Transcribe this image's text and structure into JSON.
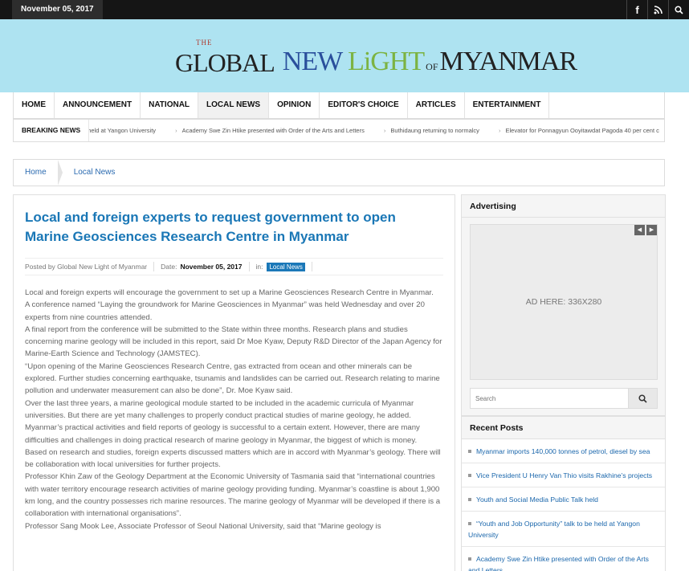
{
  "topbar": {
    "date": "November 05, 2017",
    "social": [
      {
        "icon": "facebook-icon",
        "glyph": "f"
      },
      {
        "icon": "rss-icon",
        "glyph": "⊃"
      },
      {
        "icon": "search-icon",
        "glyph": "⌕"
      }
    ]
  },
  "logo": {
    "the": "THE",
    "global": "GLOBAL",
    "new": "NEW ",
    "li": "LiGHT",
    "of": "OF",
    "myanmar": "MYANMAR"
  },
  "nav": {
    "items": [
      "HOME",
      "ANNOUNCEMENT",
      "NATIONAL",
      "LOCAL NEWS",
      "OPINION",
      "EDITOR'S CHOICE",
      "ARTICLES",
      "ENTERTAINMENT"
    ],
    "active": "LOCAL NEWS"
  },
  "breaking": {
    "label": "BREAKING NEWS",
    "items": [
      "e held at Yangon University",
      "Academy Swe Zin Htike presented with Order of the Arts and Letters",
      "Buthidaung returning to normalcy",
      "Elevator for Ponnagyun Ooyitawdat Pagoda 40 per cent c"
    ]
  },
  "breadcrumb": [
    "Home",
    "Local News"
  ],
  "article": {
    "title": "Local and foreign experts to request government to open Marine Geosciences Research Centre in Myanmar",
    "posted_by": "Posted by Global New Light of Myanmar",
    "date_label": "Date:",
    "date": "November 05, 2017",
    "in_label": "in:",
    "category": "Local News",
    "paragraphs": [
      "Local and foreign experts will encourage the government to set up a Marine Geosciences Research Centre in Myanmar.",
      "A conference named “Laying the groundwork for Marine Geosciences in Myanmar” was held Wednesday and over 20 experts from nine countries attended.",
      "A final report from the conference will be submitted to the State within three months. Research plans and studies concerning marine geology will be included in this report, said Dr Moe Kyaw, Deputy R&D Director of the Japan Agency for Marine-Earth Science and Technology (JAMSTEC).",
      "“Upon opening of the Marine Geosciences Research Centre, gas extracted from ocean and other minerals can be explored. Further studies concerning earthquake, tsunamis and landslides can be carried out. Research relating to marine pollution and underwater measurement can also be done”, Dr. Moe Kyaw said.",
      "Over the last three years, a marine geological module started to be included in the academic curricula of Myanmar universities. But there are yet many challenges to properly conduct practical studies of marine geology, he added.",
      "Myanmar’s practical activities and field reports of geology is successful to a certain extent. However, there are many difficulties and challenges in doing practical research of marine geology in Myanmar, the biggest of which is money.",
      "Based on research and studies, foreign experts discussed matters which are in accord with Myanmar’s geology. There will be collaboration with local universities for further projects.",
      "Professor Khin Zaw of the Geology Department at the Economic University of Tasmania said that “international countries with water territory encourage research activities of marine geology providing funding. Myanmar’s coastline is about 1,900 km long, and the country possesses rich marine resources. The marine geology of Myanmar will be developed if there is a collaboration with international organisations”.",
      "Professor Sang Mook Lee, Associate Professor of Seoul National University, said that “Marine geology is"
    ]
  },
  "sidebar": {
    "ad_title": "Advertising",
    "ad_text": "AD HERE: 336X280",
    "search_placeholder": "Search",
    "recent_title": "Recent Posts",
    "recent_posts": [
      "Myanmar imports 140,000 tonnes of petrol, diesel by sea",
      "Vice President U Henry Van Thio visits Rakhine’s projects",
      "Youth and Social Media Public Talk held",
      "“Youth and Job Opportunity” talk to be held at Yangon University",
      "Academy Swe Zin Htike presented with Order of the Arts and Letters"
    ]
  },
  "colors": {
    "header_bg": "#aee3f1",
    "title_blue": "#1a77b6",
    "link_blue": "#1b67ac",
    "topbar": "#151515"
  }
}
